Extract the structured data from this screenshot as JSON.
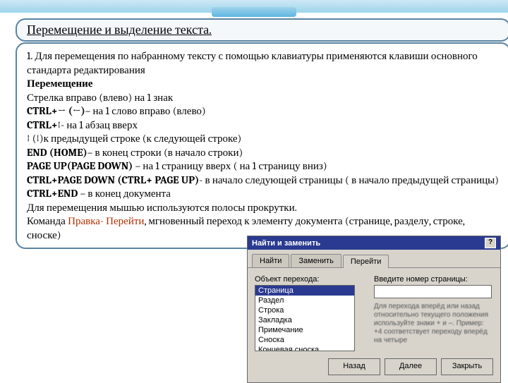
{
  "title": "Перемещение и выделение текста.",
  "content": {
    "p1": "1. Для перемещения по набранному тексту с помощью клавиатуры применяются клавиши основного стандарта редактирования",
    "h1": "Перемещение",
    "l1": "Стрелка вправо (влево) на 1 знак",
    "l2a": "CTRL+→ (←)",
    "l2b": "– на 1 слово вправо (влево)",
    "l3a": "CTRL+↑",
    "l3b": "- на 1 абзац вверх",
    "l4": "↑ (↓)к предыдущей строке (к следующей строке)",
    "l5a": "END (HOME)",
    "l5b": "– в конец строки (в начало строки)",
    "l6a": "PAGE UP(PAGE DOWN)",
    "l6b": " – на 1 страницу вверх ( на 1 страницу вниз)",
    "l7a": "CTRL+PAGE DOWN (CTRL+ PAGE UP)",
    "l7b": "- в начало следующей страницы ( в начало предыдущей страницы)",
    "l8a": "CTRL+END",
    "l8b": " – в конец документа",
    "p2": "Для перемещения мышью используются полосы прокрутки.",
    "p3a": "Команда ",
    "p3menu": "Правка- Перейти",
    "p3b": ", мгновенный переход к элементу документа (странице, разделу, строке, сноске)"
  },
  "dialog": {
    "title": "Найти и заменить",
    "tabs": [
      "Найти",
      "Заменить",
      "Перейти"
    ],
    "left_label": "Объект перехода:",
    "list": [
      "Страница",
      "Раздел",
      "Строка",
      "Закладка",
      "Примечание",
      "Сноска",
      "Концевая сноска"
    ],
    "right_label": "Введите номер страницы:",
    "hint": "Для перехода вперёд или назад относительно текущего положения используйте знаки + и –. Пример: +4 соответствует переходу вперёд на четыре",
    "buttons": [
      "Назад",
      "Далее",
      "Закрыть"
    ]
  }
}
